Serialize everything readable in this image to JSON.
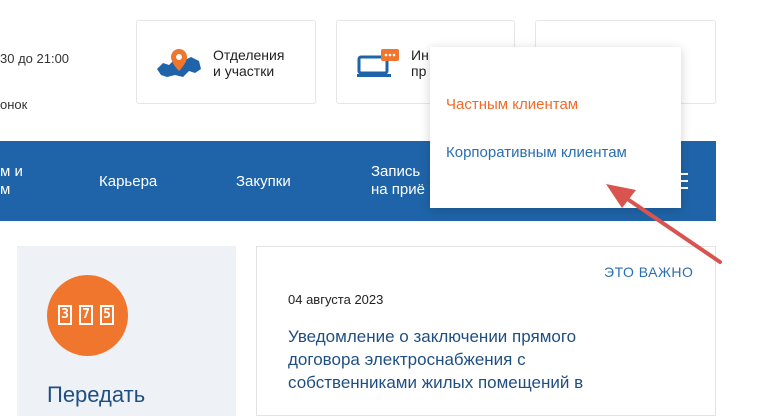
{
  "header": {
    "hours_text": "30 до 21:00",
    "call_text": "онок",
    "card_offices_line1": "Отделения",
    "card_offices_line2": "и участки",
    "card_info_line1": "Ин",
    "card_info_line2": "пр"
  },
  "nav": {
    "item1_line1": "м и",
    "item1_line2": "м",
    "career": "Карьера",
    "purchases": "Закупки",
    "appointment_line1": "Запись",
    "appointment_line2": "на приё"
  },
  "dropdown": {
    "items": [
      "Частным клиентам",
      "Корпоративным клиентам"
    ],
    "active_color": "#f06a28",
    "link_color": "#2a6fb0"
  },
  "sidebar": {
    "badge_digits": [
      "3",
      "7",
      "5"
    ],
    "title": "Передать"
  },
  "news": {
    "important_label": "ЭТО ВАЖНО",
    "date": "04 августа 2023",
    "headline_line1": "Уведомление о заключении прямого",
    "headline_line2": "договора электроснабжения с",
    "headline_line3": "собственниками жилых помещений в"
  },
  "colors": {
    "nav_bg": "#1f64a8",
    "accent_orange": "#f1762d",
    "annotation_arrow": "#d9544f"
  }
}
